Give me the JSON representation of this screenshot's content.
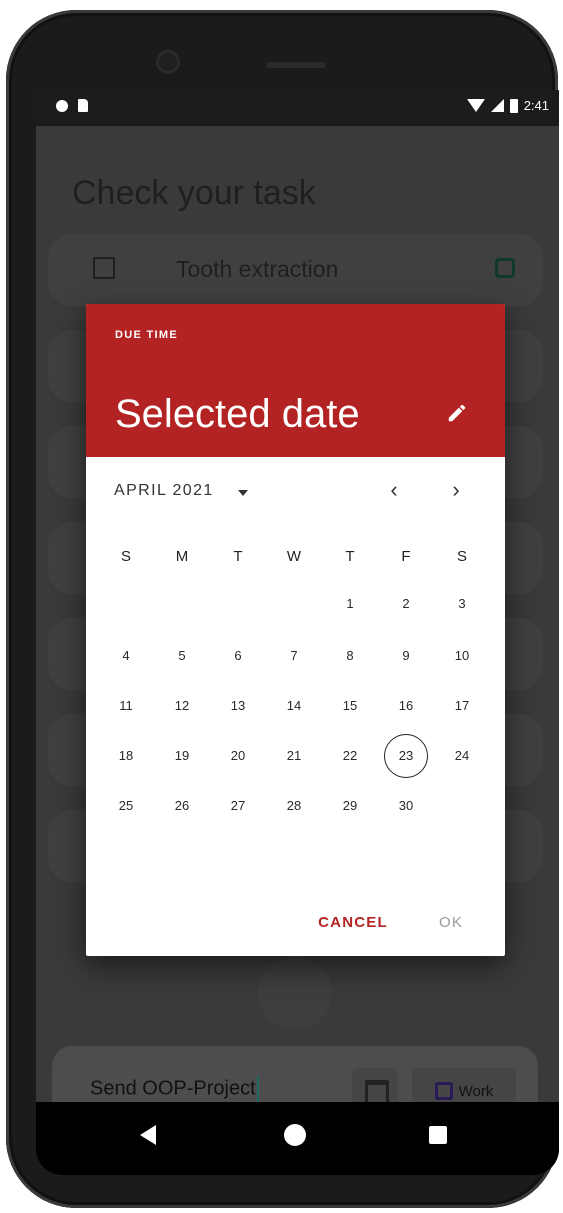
{
  "status_bar": {
    "time": "2:41"
  },
  "background_app": {
    "title": "Check your task",
    "first_task": "Tooth extraction"
  },
  "input_bar": {
    "value": "Send OOP-Project",
    "tag_label": "Work"
  },
  "dialog": {
    "header_label": "DUE TIME",
    "title": "Selected date",
    "month": "APRIL 2021",
    "weekdays": [
      "S",
      "M",
      "T",
      "W",
      "T",
      "F",
      "S"
    ],
    "weeks": [
      [
        "",
        "",
        "",
        "",
        "1",
        "2",
        "3"
      ],
      [
        "4",
        "5",
        "6",
        "7",
        "8",
        "9",
        "10"
      ],
      [
        "11",
        "12",
        "13",
        "14",
        "15",
        "16",
        "17"
      ],
      [
        "18",
        "19",
        "20",
        "21",
        "22",
        "23",
        "24"
      ],
      [
        "25",
        "26",
        "27",
        "28",
        "29",
        "30",
        ""
      ]
    ],
    "selected_day": "23",
    "cancel_label": "CANCEL",
    "ok_label": "OK"
  },
  "colors": {
    "accent": "#b42323",
    "scrim": "#323232"
  }
}
